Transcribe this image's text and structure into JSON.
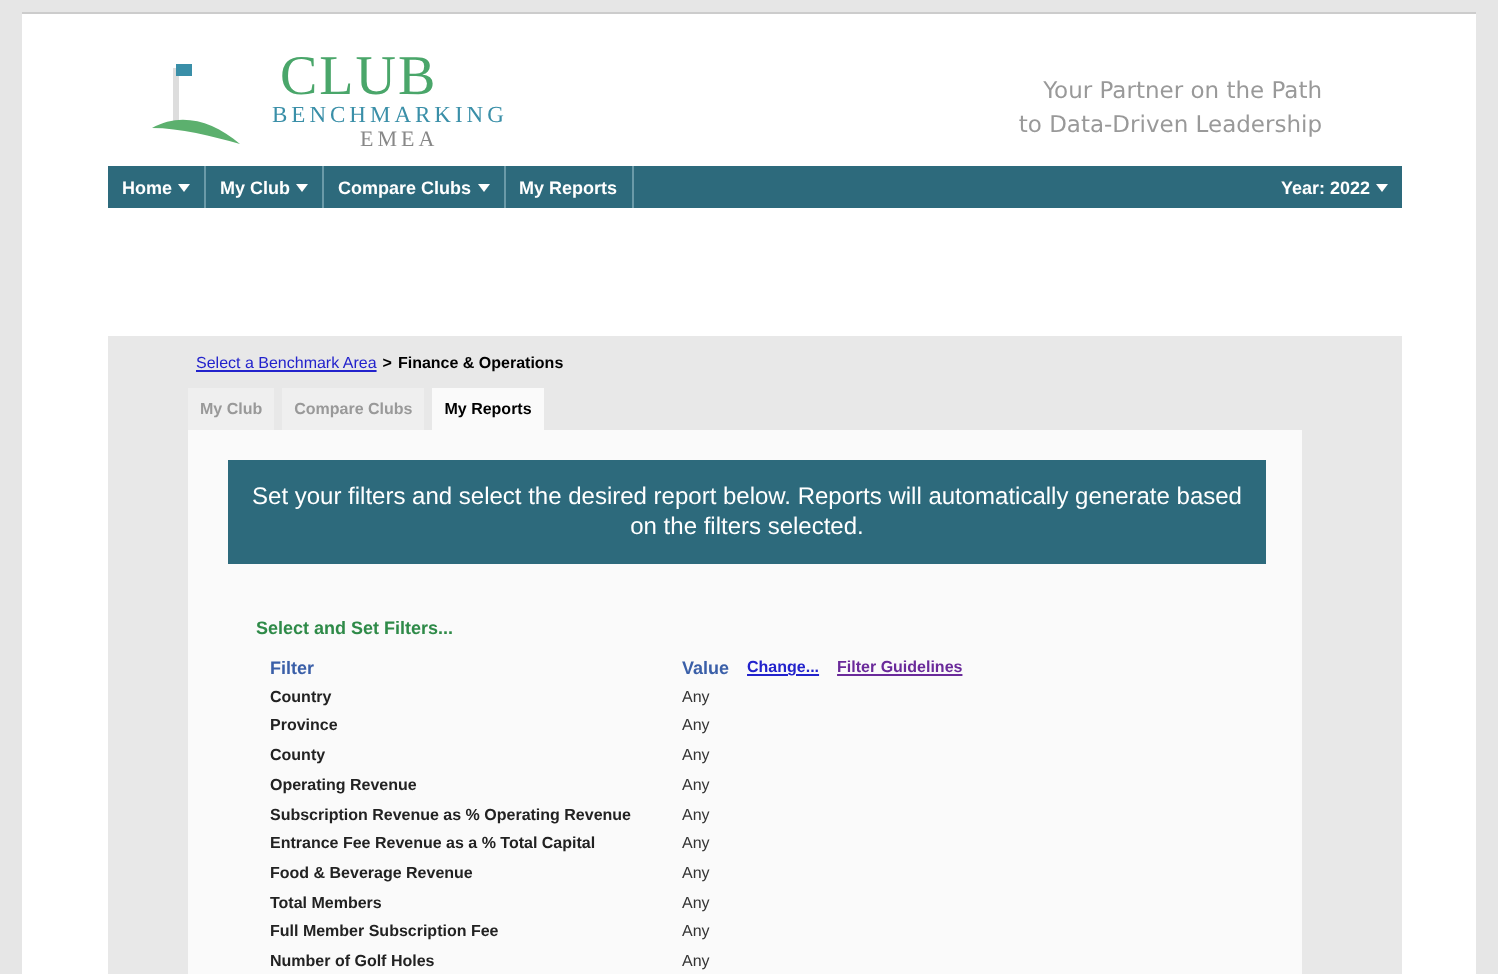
{
  "logo": {
    "title": "CLUB",
    "subtitle": "BENCHMARKING",
    "region": "EMEA"
  },
  "tagline": [
    "Your Partner on the Path",
    "to Data-Driven Leadership"
  ],
  "nav": {
    "items": [
      {
        "label": "Home",
        "dropdown": true
      },
      {
        "label": "My Club",
        "dropdown": true
      },
      {
        "label": "Compare Clubs",
        "dropdown": true
      },
      {
        "label": "My Reports",
        "dropdown": false
      }
    ],
    "year": {
      "label": "Year: 2022",
      "dropdown": true
    }
  },
  "breadcrumb": {
    "link": "Select a Benchmark Area",
    "separator": ">",
    "current": "Finance & Operations"
  },
  "tabs": [
    {
      "label": "My Club",
      "selected": false
    },
    {
      "label": "Compare Clubs",
      "selected": false
    },
    {
      "label": "My Reports",
      "selected": true
    }
  ],
  "banner": "Set your filters and select the desired report below. Reports will automatically generate based on the filters selected.",
  "filters": {
    "title": "Select and Set Filters...",
    "columns": [
      "Filter",
      "Value"
    ],
    "links": [
      "Change...",
      "Filter Guidelines"
    ],
    "rows": [
      {
        "name": "Country",
        "value": "Any"
      },
      {
        "name": "Province",
        "value": "Any"
      },
      {
        "name": "County",
        "value": "Any"
      },
      {
        "name": "Operating Revenue",
        "value": "Any"
      },
      {
        "name": "Subscription Revenue as % Operating Revenue",
        "value": "Any"
      },
      {
        "name": "Entrance Fee Revenue as a % Total Capital",
        "value": "Any"
      },
      {
        "name": "Food & Beverage Revenue",
        "value": "Any"
      },
      {
        "name": "Total Members",
        "value": "Any"
      },
      {
        "name": "Full Member Subscription Fee",
        "value": "Any"
      },
      {
        "name": "Number of Golf Holes",
        "value": "Any"
      }
    ]
  }
}
